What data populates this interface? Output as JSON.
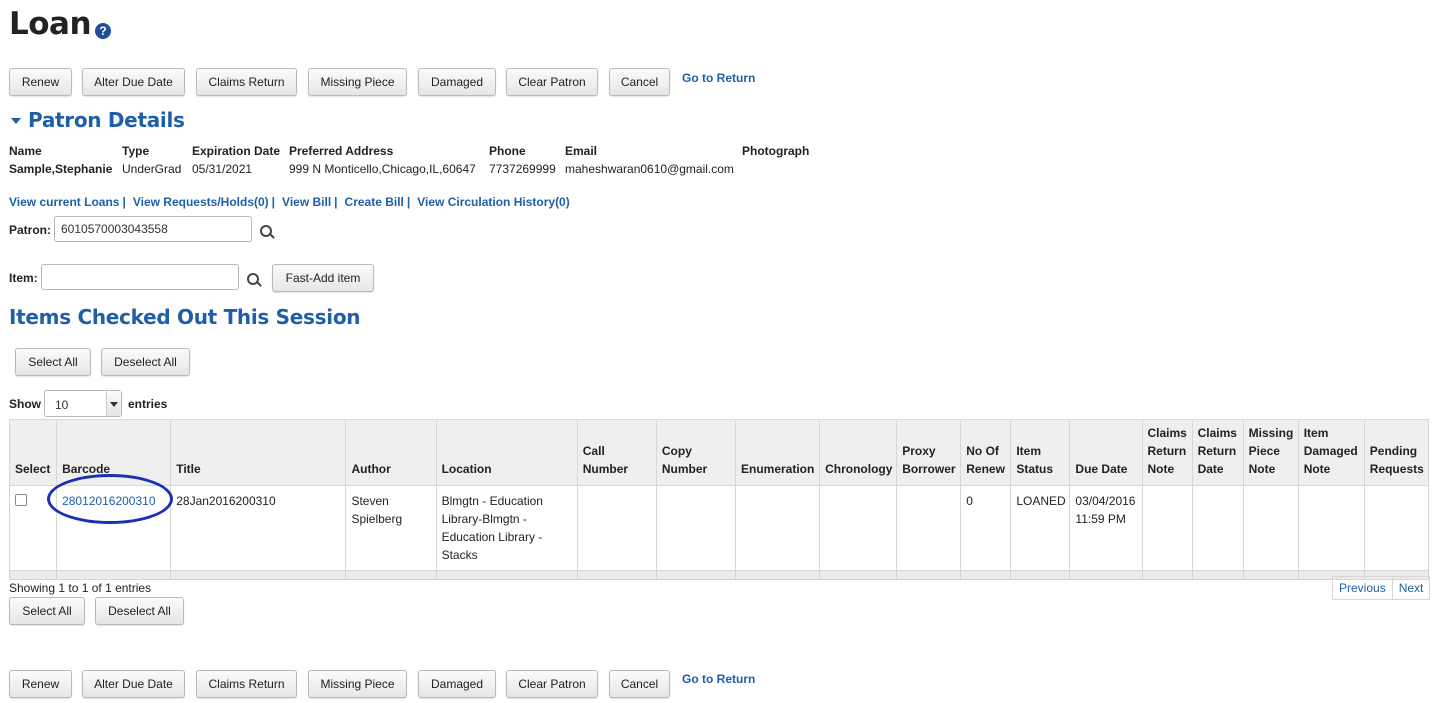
{
  "page": {
    "title": "Loan",
    "help_icon": "?"
  },
  "actions": {
    "renew": "Renew",
    "alter_due_date": "Alter Due Date",
    "claims_return": "Claims Return",
    "missing_piece": "Missing Piece",
    "damaged": "Damaged",
    "clear_patron": "Clear Patron",
    "cancel": "Cancel",
    "go_to_return": "Go to Return"
  },
  "patron_details": {
    "heading": "Patron Details",
    "headers": {
      "name": "Name",
      "type": "Type",
      "expiration_date": "Expiration Date",
      "preferred_address": "Preferred Address",
      "phone": "Phone",
      "email": "Email",
      "photograph": "Photograph"
    },
    "values": {
      "name": "Sample,Stephanie",
      "type": "UnderGrad",
      "expiration_date": "05/31/2021",
      "preferred_address": "999 N Monticello,Chicago,IL,60647",
      "phone": "7737269999",
      "email": "maheshwaran0610@gmail.com"
    }
  },
  "quick_links": {
    "current_loans": "View current Loans",
    "requests": "View Requests/Holds(0)",
    "bill": "View Bill",
    "create_bill": "Create Bill",
    "history": "View Circulation History(0)",
    "separator": "|"
  },
  "patron_field": {
    "label": "Patron:",
    "value": "6010570003043558"
  },
  "item_field": {
    "label": "Item:",
    "value": "",
    "fast_add": "Fast-Add item"
  },
  "session": {
    "heading": "Items Checked Out This Session",
    "select_all": "Select All",
    "deselect_all": "Deselect All",
    "show_label": "Show",
    "entries_label": "entries",
    "page_size": "10",
    "summary": "Showing 1 to 1 of 1 entries",
    "previous": "Previous",
    "next": "Next"
  },
  "table": {
    "columns": [
      "Select",
      "Barcode",
      "Title",
      "Author",
      "Location",
      "Call Number",
      "Copy Number",
      "Enumeration",
      "Chronology",
      "Proxy Borrower",
      "No Of Renew",
      "Item Status",
      "Due Date",
      "Claims Return Note",
      "Claims Return Date",
      "Missing Piece Note",
      "Item Damaged Note",
      "Pending Requests"
    ],
    "rows": [
      {
        "barcode": "28012016200310",
        "title": "28Jan2016200310",
        "author": "Steven Spielberg",
        "location": "Blmgtn - Education Library-Blmgtn - Education Library - Stacks",
        "call_number": "",
        "copy_number": "",
        "enumeration": "",
        "chronology": "",
        "proxy_borrower": "",
        "no_of_renew": "0",
        "item_status": "LOANED",
        "due_date": "03/04/2016 11:59 PM",
        "claims_return_note": "",
        "claims_return_date": "",
        "missing_piece_note": "",
        "item_damaged_note": "",
        "pending_requests": ""
      }
    ]
  },
  "colors": {
    "link": "#1f5fa9",
    "highlight_circle": "#1a2fb6",
    "header_bg": "#efefef"
  }
}
